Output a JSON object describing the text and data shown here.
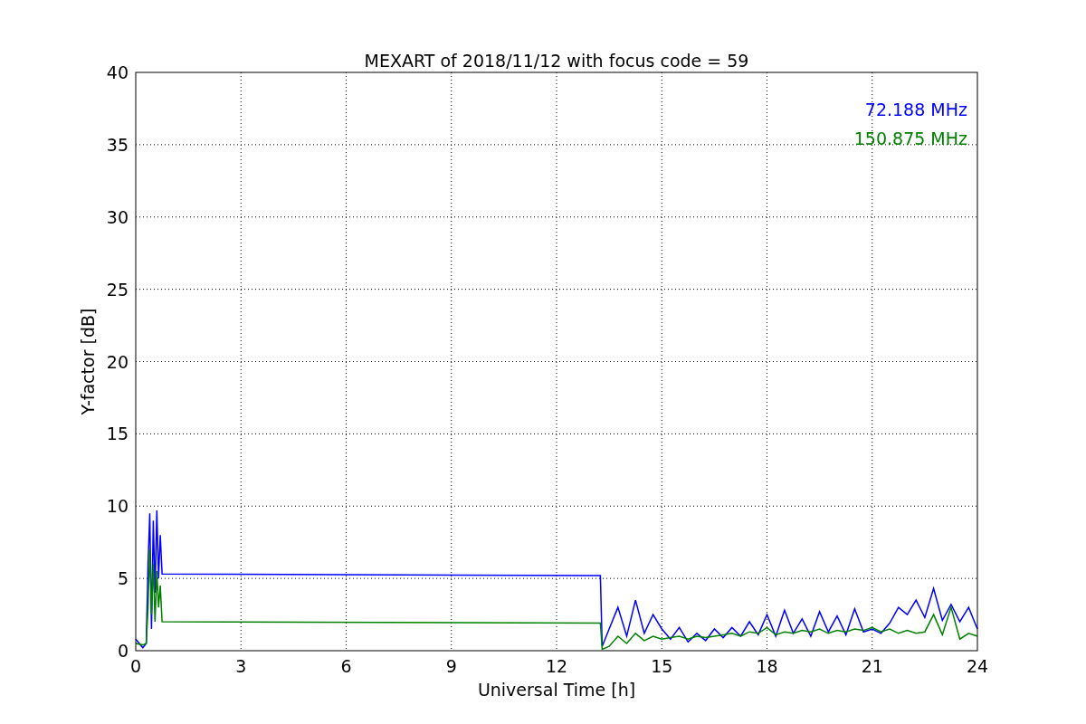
{
  "figure": {
    "chart_data": {
      "type": "line",
      "title": "MEXART of 2018/11/12 with focus code = 59",
      "xlabel": "Universal Time [h]",
      "ylabel": "Y-factor [dB]",
      "x": [
        0,
        0.2,
        0.3,
        0.35,
        0.4,
        0.45,
        0.5,
        0.55,
        0.6,
        0.65,
        0.7,
        0.75,
        13.25,
        13.3,
        13.5,
        13.75,
        14,
        14.25,
        14.5,
        14.75,
        15,
        15.25,
        15.5,
        15.75,
        16,
        16.25,
        16.5,
        16.75,
        17,
        17.25,
        17.5,
        17.75,
        18,
        18.25,
        18.5,
        18.75,
        19,
        19.25,
        19.5,
        19.75,
        20,
        20.25,
        20.5,
        20.75,
        21,
        21.25,
        21.5,
        21.75,
        22,
        22.25,
        22.5,
        22.75,
        23,
        23.25,
        23.5,
        23.75,
        24
      ],
      "series": [
        {
          "name": "72.188 MHz",
          "color": "#0000ff",
          "values": [
            0.8,
            0.2,
            0.5,
            6,
            9.5,
            1.5,
            9,
            4,
            9.7,
            5,
            8,
            5.3,
            5.2,
            0.3,
            1.5,
            3,
            1,
            3.5,
            1.2,
            2.5,
            1.5,
            0.8,
            1.6,
            0.6,
            1.2,
            0.7,
            1.5,
            0.9,
            1.6,
            1,
            2,
            1.1,
            2.5,
            1,
            2.8,
            1.2,
            2.2,
            1,
            2.7,
            1.3,
            2.4,
            1.1,
            2.9,
            1.3,
            1.5,
            1.2,
            1.9,
            3,
            2.5,
            3.5,
            2.3,
            4.3,
            2.1,
            3.2,
            2,
            3,
            1.5
          ]
        },
        {
          "name": "150.875 MHz",
          "color": "#008000",
          "values": [
            0.5,
            0.4,
            0.5,
            3,
            7,
            2.5,
            6,
            2,
            5.5,
            3,
            4.5,
            2.0,
            1.9,
            0.1,
            0.3,
            1,
            0.5,
            1.2,
            0.7,
            1,
            0.8,
            0.9,
            1,
            0.8,
            1,
            0.9,
            1,
            1.1,
            1.2,
            1,
            1.3,
            1.2,
            1.6,
            1.1,
            1.3,
            1.2,
            1.4,
            1.3,
            1.5,
            1.2,
            1.4,
            1.3,
            1.5,
            1.4,
            1.6,
            1.3,
            1.5,
            1.2,
            1.4,
            1.2,
            1.3,
            2.5,
            1.1,
            3,
            0.8,
            1.2,
            1
          ]
        }
      ],
      "grid": true,
      "xlim": [
        0,
        24
      ],
      "ylim": [
        0,
        40
      ],
      "xticks": [
        0,
        3,
        6,
        9,
        12,
        15,
        18,
        21,
        24
      ],
      "yticks": [
        0,
        5,
        10,
        15,
        20,
        25,
        30,
        35,
        40
      ]
    }
  }
}
